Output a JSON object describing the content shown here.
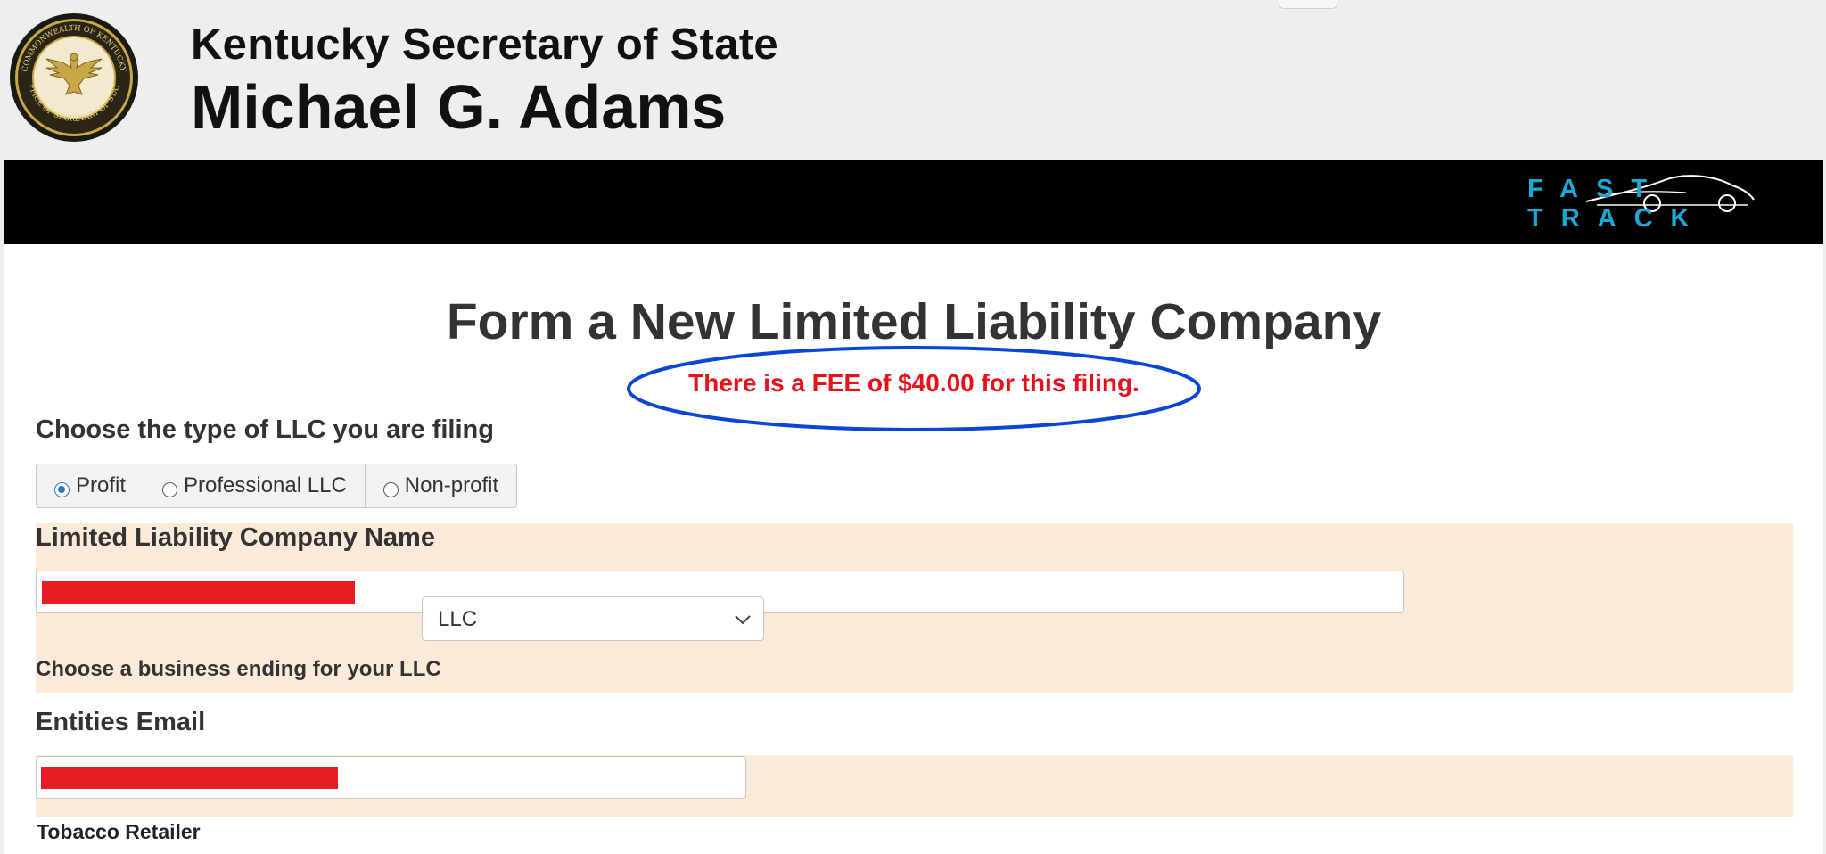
{
  "header": {
    "agency": "Kentucky Secretary of State",
    "official": "Michael G. Adams",
    "seal_text_top": "COMMONWEALTH OF KENTUCKY",
    "seal_text_bottom": "OFFICE OF SECRETARY OF STATE"
  },
  "banner": {
    "brand": "FAST TRACK",
    "brand_color": "#1ba8d6"
  },
  "form": {
    "title": "Form a New Limited Liability Company",
    "fee_notice": "There is a FEE of $40.00 for this filing.",
    "fee_color": "#e8101a",
    "highlight_color": "#0a46d6",
    "llc_type": {
      "label": "Choose the type of LLC you are filing",
      "options": [
        {
          "label": "Profit",
          "selected": true
        },
        {
          "label": "Professional LLC",
          "selected": false
        },
        {
          "label": "Non-profit",
          "selected": false
        }
      ]
    },
    "company_name": {
      "label": "Limited Liability Company Name",
      "value": ""
    },
    "ending": {
      "label": "Choose a business ending for your LLC",
      "selected": "LLC"
    },
    "email": {
      "label": "Entities Email",
      "value": ""
    },
    "tobacco": {
      "label": "Tobacco Retailer"
    },
    "section_bg": "#fbeada",
    "redaction_color": "#e51e25"
  }
}
